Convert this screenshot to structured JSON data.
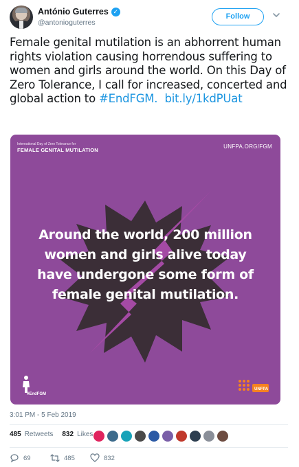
{
  "author": {
    "name": "António Guterres",
    "handle": "@antonioguterres",
    "verified": true
  },
  "header": {
    "follow_label": "Follow"
  },
  "tweet": {
    "text": "Female genital mutilation is an abhorrent human rights violation causing horrendous suffering to women and girls around the world. On this Day of Zero Tolerance, I call for increased, concerted and global action to",
    "hashtag": "#EndFGM.",
    "link": "bit.ly/1kdPUat"
  },
  "media": {
    "top_left_small": "International Day of Zero Tolerance for",
    "top_left_big": "FEMALE GENITAL MUTILATION",
    "top_right": "UNFPA.ORG/FGM",
    "quote": "Around the world, 200 million women and girls alive today have undergone some form of female genital mutilation.",
    "bottom_tag": "#EndFGM",
    "logo_text": "UNFPA",
    "colors": {
      "background": "#8e4a9a",
      "burst": "#3b2e37",
      "bolt": "#a44aa4",
      "logo": "#f58220"
    }
  },
  "timestamp": "3:01 PM - 5 Feb 2019",
  "stats": {
    "retweets": "485",
    "retweets_label": "Retweets",
    "likes": "832",
    "likes_label": "Likes"
  },
  "likers": [
    "#e0245e",
    "#3d6b8c",
    "#17a2b8",
    "#4a4a4a",
    "#2b5aa5",
    "#7a5fa8",
    "#c0392b",
    "#2d3e50",
    "#8a8f99",
    "#6d4c41"
  ],
  "actions": {
    "reply_count": "69",
    "retweet_count": "485",
    "like_count": "832"
  },
  "colors": {
    "accent": "#1da1f2",
    "link": "#1b95e0",
    "muted": "#657786"
  }
}
